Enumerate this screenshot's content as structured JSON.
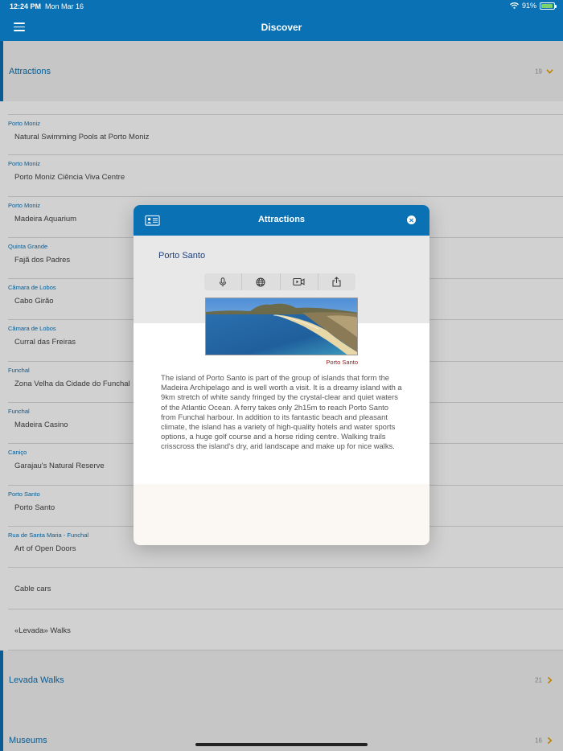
{
  "status": {
    "time": "12:24 PM",
    "date": "Mon Mar 16",
    "battery": "91%",
    "battery_level": 0.91
  },
  "nav": {
    "title": "Discover",
    "menu_icon": "hamburger-icon"
  },
  "sections": {
    "attractions": {
      "title": "Attractions",
      "count": "19"
    },
    "levada": {
      "title": "Levada Walks",
      "count": "21"
    },
    "museums": {
      "title": "Museums",
      "count": "16"
    }
  },
  "list": [
    {
      "location": "Porto Moniz",
      "name": "Natural Swimming Pools at Porto Moniz"
    },
    {
      "location": "Porto Moniz",
      "name": "Porto Moniz Ciência Viva Centre"
    },
    {
      "location": "Porto Moniz",
      "name": "Madeira Aquarium"
    },
    {
      "location": "Quinta Grande",
      "name": "Fajã dos Padres"
    },
    {
      "location": "Câmara de Lobos",
      "name": "Cabo Girão"
    },
    {
      "location": "Câmara de Lobos",
      "name": "Curral das Freiras"
    },
    {
      "location": "Funchal",
      "name": "Zona Velha da Cidade do Funchal"
    },
    {
      "location": "Funchal",
      "name": "Madeira Casino"
    },
    {
      "location": "Caniço",
      "name": "Garajau's Natural Reserve"
    },
    {
      "location": "Porto Santo",
      "name": "Porto Santo"
    },
    {
      "location": "Rua de Santa Maria - Funchal",
      "name": "Art of Open Doors"
    },
    {
      "location": "",
      "name": "Cable cars"
    },
    {
      "location": "",
      "name": "«Levada» Walks"
    }
  ],
  "modal": {
    "title": "Attractions",
    "place": "Porto Santo",
    "caption": "Porto Santo",
    "description": "The island of Porto Santo is part of the group of islands that form the Madeira Archipelago and is well worth a visit. It is a dreamy island with a 9km stretch of white sandy fringed by the crystal-clear and quiet waters of the Atlantic Ocean. A ferry takes only 2h15m to reach Porto Santo from Funchal harbour. In addition to its fantastic beach and pleasant climate, the island has a variety of high-quality hotels and water sports options, a huge golf course and a horse riding centre. Walking trails crisscross the island's dry, arid landscape and make up for nice walks.",
    "tools": [
      "microphone-icon",
      "globe-icon",
      "video-icon",
      "share-icon"
    ]
  },
  "colors": {
    "brand": "#0a71b4",
    "accent": "#e5a100",
    "caption": "#8b1a1a"
  }
}
